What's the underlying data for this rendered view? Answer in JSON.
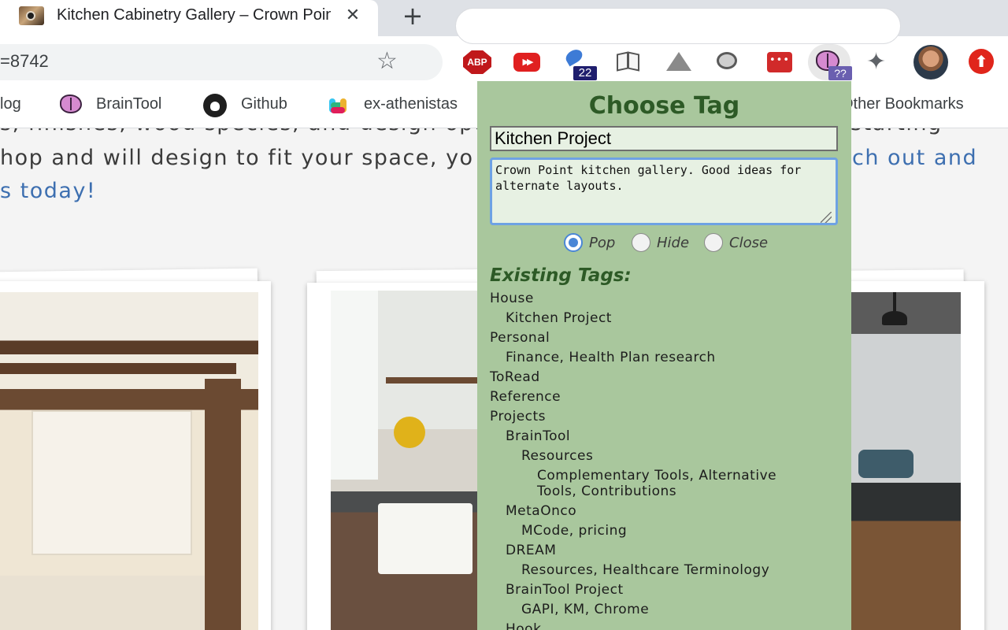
{
  "browser": {
    "tab_title": "Kitchen Cabinetry Gallery – Crown Point",
    "tab_close": "✕",
    "new_tab": "+",
    "url_fragment": "=8742",
    "star": "☆",
    "extensions": {
      "abp": "ABP",
      "yt_fwd": "▶▶",
      "key_badge": "22",
      "lastpass": "•••",
      "braintool_badge": "??",
      "puzzle": "✦",
      "update": "⬆"
    },
    "icons": [
      "tab-favicon",
      "star-icon",
      "abp-icon",
      "fast-forward-icon",
      "key-icon",
      "book-icon",
      "drive-icon",
      "lens-icon",
      "lastpass-icon",
      "braintool-brain-icon",
      "puzzle-icon",
      "avatar",
      "update-icon"
    ],
    "bookmarks": [
      {
        "label": "log"
      },
      {
        "label": "BrainTool"
      },
      {
        "label": "Github"
      },
      {
        "label": "ex-athenistas"
      },
      {
        "label": "Other Bookmarks"
      }
    ]
  },
  "page": {
    "line1": "s, finishes, wood species, and design options",
    "line1_right": "starting",
    "line2_left": "hop and will design to fit your space, yo",
    "line2_link": "ch out and",
    "line3_link": "s today!"
  },
  "popup": {
    "title": "Choose Tag",
    "tag_value": "Kitchen Project",
    "note_value": "Crown Point kitchen gallery. Good ideas for alternate layouts.",
    "radio_options": [
      {
        "label": "Pop",
        "selected": true
      },
      {
        "label": "Hide",
        "selected": false
      },
      {
        "label": "Close",
        "selected": false
      }
    ],
    "existing_heading": "Existing Tags:",
    "tags": [
      {
        "label": "House",
        "level": 0
      },
      {
        "label": "Kitchen Project",
        "level": 1
      },
      {
        "label": "Personal",
        "level": 0
      },
      {
        "label": "Finance, Health Plan research",
        "level": 1
      },
      {
        "label": "ToRead",
        "level": 0
      },
      {
        "label": "Reference",
        "level": 0
      },
      {
        "label": "Projects",
        "level": 0
      },
      {
        "label": "BrainTool",
        "level": 1
      },
      {
        "label": "Resources",
        "level": 2
      },
      {
        "label": "Complementary Tools, Alternative Tools, Contributions",
        "level": 3
      },
      {
        "label": "MetaOnco",
        "level": 1
      },
      {
        "label": "MCode, pricing",
        "level": 2
      },
      {
        "label": "DREAM",
        "level": 1
      },
      {
        "label": "Resources, Healthcare Terminology",
        "level": 2
      },
      {
        "label": "BrainTool Project",
        "level": 1
      },
      {
        "label": "GAPI, KM, Chrome",
        "level": 2
      },
      {
        "label": "Hook",
        "level": 1
      }
    ]
  },
  "colors": {
    "popup_bg": "#a9c79d",
    "popup_title": "#2d5a26",
    "link": "#3d6fb0",
    "input_bg": "#e7f1e3"
  }
}
